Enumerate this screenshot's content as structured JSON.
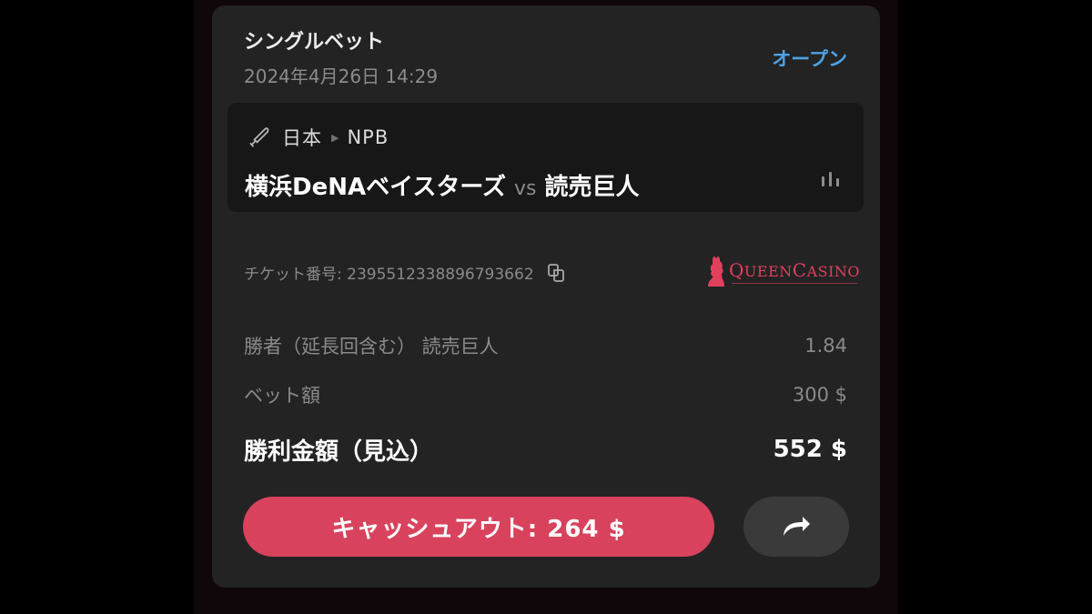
{
  "bet": {
    "title": "シングルベット",
    "datetime": "2024年4月26日 14:29",
    "status": "オープン",
    "status_color": "#4da2e6"
  },
  "event": {
    "sport_icon": "baseball-bat-icon",
    "country": "日本",
    "league": "NPB",
    "home_team": "横浜DeNAベイスターズ",
    "vs_text": "vs",
    "away_team": "読売巨人",
    "stats_icon": "bar-chart-icon"
  },
  "ticket": {
    "label": "チケット番号: 2395512338896793662",
    "copy_icon": "copy-icon"
  },
  "brand": {
    "logo_letters": [
      "Q",
      "UEEN",
      "C",
      "ASINO"
    ],
    "brand_color": "#e0405e"
  },
  "selection": {
    "market_label": "勝者（延長回含む） 読売巨人",
    "odds": "1.84"
  },
  "stake": {
    "label": "ベット額",
    "value": "300 $"
  },
  "payout": {
    "label": "勝利金額（見込）",
    "value": "552 $"
  },
  "actions": {
    "cashout_label": "キャッシュアウト: 264 $",
    "cashout_color": "#d8425d",
    "share_icon": "share-arrow-icon"
  }
}
